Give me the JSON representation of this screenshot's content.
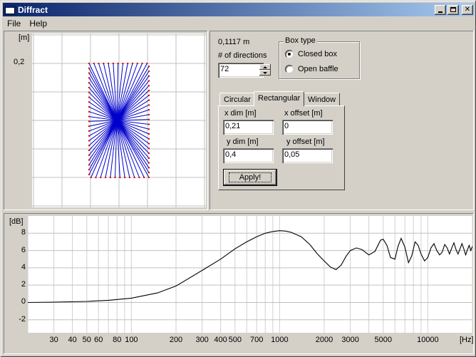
{
  "window": {
    "title": "Diffract"
  },
  "menu": {
    "items": [
      "File",
      "Help"
    ]
  },
  "geometry_plot": {
    "unit_label": "[m]",
    "y_tick_label": "0,2",
    "grid_color": "#c0c0c0",
    "ray_color": "#0000cc",
    "edge_point_color": "#cc0000",
    "box_x_dim_m": 0.21,
    "box_y_dim_m": 0.4,
    "source_offset_x_m": 0,
    "source_offset_y_m": 0.05,
    "directions": 72
  },
  "controls": {
    "readout": "0,1117 m",
    "directions_label": "# of directions",
    "directions_value": "72",
    "box_type": {
      "legend": "Box type",
      "options": [
        "Closed box",
        "Open baffle"
      ],
      "selected": "Closed box"
    },
    "tabs": [
      "Circular",
      "Rectangular",
      "Window"
    ],
    "active_tab": "Rectangular",
    "fields": {
      "x_dim_label": "x dim [m]",
      "x_dim_value": "0,21",
      "x_offset_label": "x offset [m]",
      "x_offset_value": "0",
      "y_dim_label": "y dim [m]",
      "y_dim_value": "0,4",
      "y_offset_label": "y offset [m]",
      "y_offset_value": "0,05"
    },
    "apply_label": "Apply!"
  },
  "chart_data": {
    "type": "line",
    "title": "",
    "xlabel": "[Hz]",
    "ylabel": "[dB]",
    "x_scale": "log",
    "xlim": [
      20,
      20000
    ],
    "ylim": [
      -3.5,
      10
    ],
    "grid": true,
    "x_tick_labels": [
      "30",
      "40",
      "50",
      "60",
      "80",
      "100",
      "200",
      "300",
      "400",
      "500",
      "700",
      "1000",
      "2000",
      "3000",
      "5000",
      "10000"
    ],
    "x_ticks": [
      30,
      40,
      50,
      60,
      80,
      100,
      200,
      300,
      400,
      500,
      700,
      1000,
      2000,
      3000,
      5000,
      10000
    ],
    "y_ticks": [
      -2,
      0,
      2,
      4,
      6,
      8
    ],
    "line_color": "#000000",
    "series": [
      {
        "x": [
          20,
          30,
          50,
          70,
          100,
          150,
          200,
          300,
          400,
          500,
          600,
          700,
          800,
          900,
          1000,
          1100,
          1200,
          1400,
          1600,
          1800,
          2000,
          2200,
          2400,
          2600,
          2800,
          3000,
          3300,
          3600,
          4000,
          4400,
          4800,
          5000,
          5300,
          5600,
          6000,
          6300,
          6600,
          7000,
          7400,
          7800,
          8200,
          8600,
          9000,
          9500,
          10000,
          10500,
          11000,
          11500,
          12000,
          12500,
          13000,
          13500,
          14000,
          14500,
          15000,
          15500,
          16000,
          16500,
          17000,
          17500,
          18000,
          18500,
          19000,
          19500,
          20000
        ],
        "y": [
          0,
          0.04,
          0.12,
          0.25,
          0.5,
          1.1,
          1.9,
          3.7,
          5.0,
          6.2,
          7.0,
          7.6,
          8.0,
          8.2,
          8.3,
          8.25,
          8.1,
          7.6,
          6.7,
          5.6,
          4.8,
          4.1,
          3.8,
          4.3,
          5.3,
          6.0,
          6.3,
          6.1,
          5.5,
          5.9,
          7.2,
          7.3,
          6.6,
          5.2,
          5.0,
          6.5,
          7.4,
          6.4,
          4.6,
          5.4,
          7.0,
          6.6,
          5.6,
          4.8,
          5.2,
          6.3,
          6.8,
          6.0,
          5.5,
          5.8,
          6.7,
          6.3,
          5.6,
          6.3,
          6.9,
          6.1,
          5.6,
          6.2,
          6.8,
          6.2,
          5.5,
          6.1,
          6.6,
          6.0,
          6.5
        ]
      }
    ]
  }
}
